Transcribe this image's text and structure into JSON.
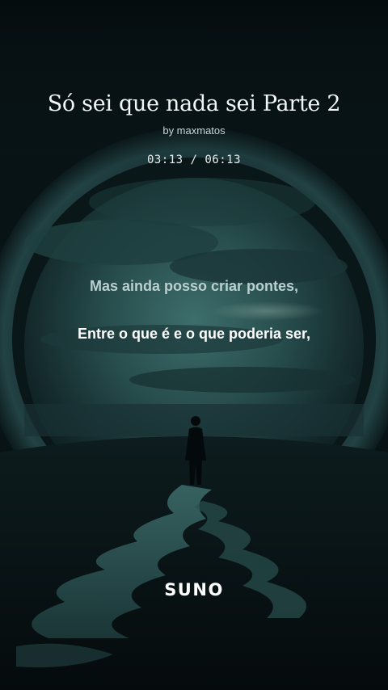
{
  "song": {
    "title": "Só sei que nada sei Parte 2",
    "artist": "by maxmatos",
    "time_display": "03:13 / 06:13",
    "elapsed": "03:13",
    "duration": "06:13"
  },
  "lyrics": {
    "faded_line": "",
    "previous_line": "Mas ainda posso criar pontes,",
    "current_line": "Entre o que é e o que poderia ser,"
  },
  "branding": {
    "logo_text": "SUNO"
  },
  "colors": {
    "background": "#061013",
    "portal_teal": "#2d5c5a",
    "lyric_previous": "#b9cfd0",
    "lyric_current": "#ffffff"
  }
}
